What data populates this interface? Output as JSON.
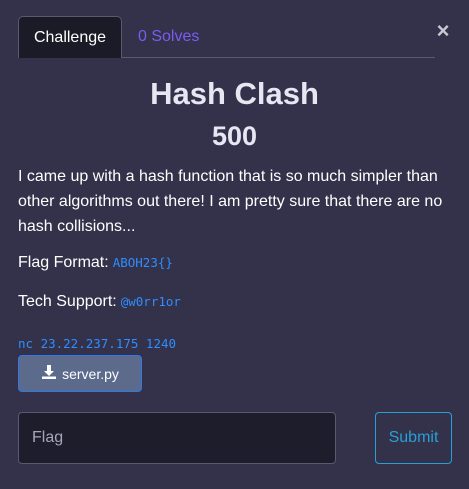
{
  "tabs": {
    "challenge_label": "Challenge",
    "solves_label": "0 Solves"
  },
  "close_glyph": "×",
  "challenge": {
    "name": "Hash Clash",
    "points": "500",
    "description": "I came up with a hash function that is so much simpler than other algorithms out there! I am pretty sure that there are no hash collisions...",
    "flag_format_label": "Flag Format:",
    "flag_format_value": "ABOH23{}",
    "tech_support_label": "Tech Support:",
    "tech_support_value": "@w0rr1or",
    "connection": "nc 23.22.237.175 1240",
    "file_name": "server.py"
  },
  "form": {
    "flag_placeholder": "Flag",
    "submit_label": "Submit"
  },
  "colors": {
    "background": "#33324a",
    "link": "#7a5cf0",
    "code": "#2f8dff",
    "submit": "#27a0d6"
  },
  "icons": {
    "download": "download-icon",
    "close": "close-icon"
  }
}
